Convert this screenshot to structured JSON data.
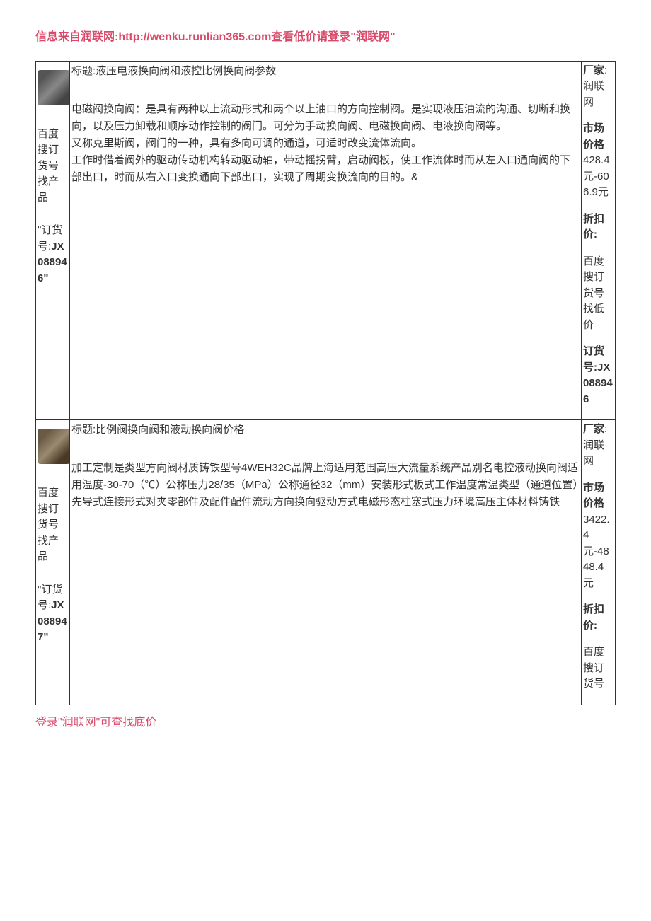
{
  "header": "信息来自润联网:http://wenku.runlian365.com查看低价请登录\"润联网\"",
  "footer": "登录\"润联网\"可查找底价",
  "rows": [
    {
      "left": {
        "search_hint": "百度搜订货号找产品",
        "order_label": "\"订货号:",
        "order_no": "JX088946\""
      },
      "mid": {
        "title": "标题:液压电液换向阀和液控比例换向阀参数",
        "body": "电磁阀换向阀：是具有两种以上流动形式和两个以上油口的方向控制阀。是实现液压油流的沟通、切断和换向，以及压力卸载和顺序动作控制的阀门。可分为手动换向阀、电磁换向阀、电液换向阀等。\n又称克里斯阀，阀门的一种，具有多向可调的通道，可适时改变流体流向。\n工作时借着阀外的驱动传动机构转动驱动轴，带动摇拐臂，启动阀板，使工作流体时而从左入口通向阀的下部出口，时而从右入口变换通向下部出口，实现了周期变换流向的目的。&"
      },
      "right": {
        "maker_label": "厂家",
        "maker": ":润联网",
        "price_label": "市场价格",
        "price": "428.4元-606.9元",
        "discount_label": "折扣价:",
        "search_hint": "百度搜订货号找低价",
        "order_label": "订货号:",
        "order_no": "JX088946"
      }
    },
    {
      "left": {
        "search_hint": "百度搜订货号找产品",
        "order_label": "\"订货号:",
        "order_no": "JX088947\""
      },
      "mid": {
        "title": "标题:比例阀换向阀和液动换向阀价格",
        "body": "加工定制是类型方向阀材质铸铁型号4WEH32C品牌上海适用范围高压大流量系统产品别名电控液动换向阀适用温度-30-70（℃）公称压力28/35（MPa）公称通径32（mm）安装形式板式工作温度常温类型（通道位置）先导式连接形式对夹零部件及配件配件流动方向换向驱动方式电磁形态柱塞式压力环境高压主体材料铸铁"
      },
      "right": {
        "maker_label": "厂家",
        "maker": ":润联网",
        "price_label": "市场价格",
        "price": "3422.4元-4848.4元",
        "discount_label": "折扣价:",
        "search_hint": "百度搜订货号"
      }
    }
  ]
}
